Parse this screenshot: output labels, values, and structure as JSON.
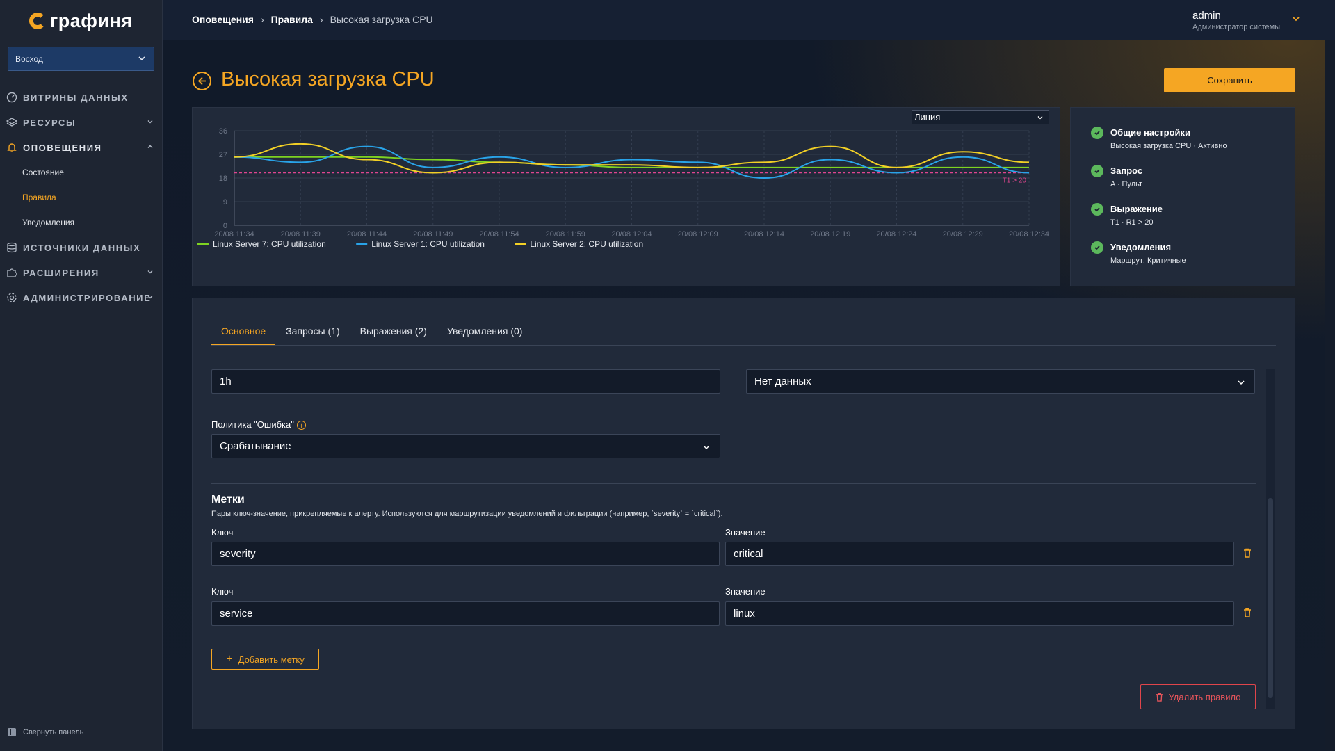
{
  "app": {
    "logo_text": "графиня"
  },
  "sidebar": {
    "org": "Восход",
    "items": [
      {
        "label": "Витрины данных",
        "icon": "dashboard-icon"
      },
      {
        "label": "Ресурсы",
        "icon": "layers-icon"
      },
      {
        "label": "Оповещения",
        "icon": "bell-icon"
      },
      {
        "label": "Источники данных",
        "icon": "database-icon"
      },
      {
        "label": "Расширения",
        "icon": "puzzle-icon"
      },
      {
        "label": "Администрирование",
        "icon": "gear-icon"
      }
    ],
    "alert_subitems": [
      "Состояние",
      "Правила",
      "Уведомления"
    ],
    "collapse_label": "Свернуть панель"
  },
  "breadcrumb": [
    "Оповещения",
    "Правила",
    "Высокая загрузка CPU"
  ],
  "user": {
    "name": "admin",
    "role": "Администратор системы"
  },
  "page": {
    "title": "Высокая загрузка CPU",
    "save_label": "Сохранить"
  },
  "viz_select": "Линия",
  "chart_data": {
    "type": "line",
    "x": [
      "20/08 11:34",
      "20/08 11:39",
      "20/08 11:44",
      "20/08 11:49",
      "20/08 11:54",
      "20/08 11:59",
      "20/08 12:04",
      "20/08 12:09",
      "20/08 12:14",
      "20/08 12:19",
      "20/08 12:24",
      "20/08 12:29",
      "20/08 12:34"
    ],
    "ylim": [
      0,
      36
    ],
    "yticks": [
      0,
      9,
      18,
      27,
      36
    ],
    "threshold": {
      "value": 20,
      "label": "T1 > 20",
      "color": "#e0458f"
    },
    "series": [
      {
        "name": "Linux Server 7: CPU utilization",
        "color": "#7ed321",
        "values": [
          26,
          26,
          26,
          25,
          24,
          23,
          22,
          22,
          22,
          22,
          22,
          22,
          22
        ]
      },
      {
        "name": "Linux Server 1: CPU utilization",
        "color": "#29a3e8",
        "values": [
          26,
          24,
          30,
          22,
          26,
          22,
          25,
          24,
          18,
          25,
          20,
          26,
          20
        ]
      },
      {
        "name": "Linux Server 2: CPU utilization",
        "color": "#f2d026",
        "values": [
          26,
          31,
          25,
          20,
          24,
          23,
          23,
          22,
          24,
          30,
          22,
          28,
          24
        ]
      }
    ]
  },
  "steps": [
    {
      "title": "Общие настройки",
      "desc": "Высокая загрузка CPU · Активно"
    },
    {
      "title": "Запрос",
      "desc": "A · Пульт"
    },
    {
      "title": "Выражение",
      "desc": "T1 · R1 > 20"
    },
    {
      "title": "Уведомления",
      "desc": "Маршрут: Критичные"
    }
  ],
  "tabs": [
    "Основное",
    "Запросы (1)",
    "Выражения (2)",
    "Уведомления (0)"
  ],
  "form": {
    "interval_value": "1h",
    "nodata_value": "Нет данных",
    "error_policy_label": "Политика \"Ошибка\"",
    "error_policy_value": "Срабатывание",
    "labels_title": "Метки",
    "labels_desc": "Пары ключ-значение, прикрепляемые к алерту. Используются для маршрутизации уведомлений и фильтрации (например, `severity` = `critical`).",
    "key_label": "Ключ",
    "value_label": "Значение",
    "rows": [
      {
        "key": "severity",
        "value": "critical"
      },
      {
        "key": "service",
        "value": "linux"
      }
    ],
    "add_label": "Добавить метку",
    "delete_label": "Удалить правило"
  }
}
